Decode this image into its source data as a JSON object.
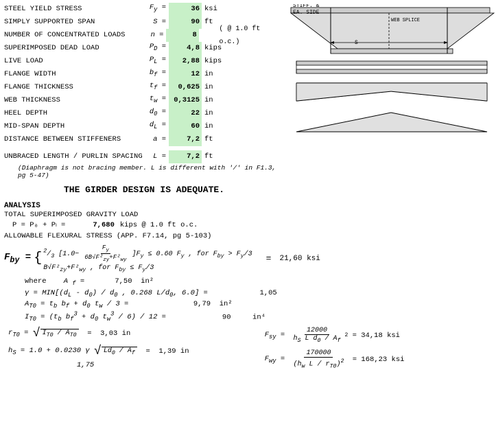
{
  "params": [
    {
      "label": "STEEL YIELD STRESS",
      "sym": "F y",
      "val": "36",
      "unit": "ksi",
      "note": ""
    },
    {
      "label": "SIMPLY SUPPORTED SPAN",
      "sym": "S",
      "val": "90",
      "unit": "ft",
      "note": ""
    },
    {
      "label": "NUMBER OF CONCENTRATED LOADS",
      "sym": "n",
      "val": "8",
      "unit": "",
      "note": "( @ 1.0 ft o.c.)"
    },
    {
      "label": "SUPERIMPOSED DEAD LOAD",
      "sym": "P D",
      "val": "4,8",
      "unit": "kips",
      "note": ""
    },
    {
      "label": "LIVE LOAD",
      "sym": "P L",
      "val": "2,88",
      "unit": "kips",
      "note": ""
    },
    {
      "label": "FLANGE WIDTH",
      "sym": "b f",
      "val": "12",
      "unit": "in",
      "note": ""
    },
    {
      "label": "FLANGE THICKNESS",
      "sym": "t f",
      "val": "0,625",
      "unit": "in",
      "note": ""
    },
    {
      "label": "WEB THICKNESS",
      "sym": "t w",
      "val": "0,3125",
      "unit": "in",
      "note": ""
    },
    {
      "label": "HEEL DEPTH",
      "sym": "d 0",
      "val": "22",
      "unit": "in",
      "note": ""
    },
    {
      "label": "MID-SPAN DEPTH",
      "sym": "d L",
      "val": "60",
      "unit": "in",
      "note": ""
    },
    {
      "label": "DISTANCE BETWEEN STIFFENERS",
      "sym": "a",
      "val": "7,2",
      "unit": "ft",
      "note": ""
    },
    {
      "label": "",
      "sym": "",
      "val": "",
      "unit": "",
      "note": ""
    },
    {
      "label": "UNBRACED LENGTH / PURLIN SPACING",
      "sym": "L",
      "val": "7,2",
      "unit": "ft",
      "note": ""
    }
  ],
  "diaphragm_note": "(Diaphragm is not bracing member. L is different with '/' in F1.3, pg 5-47)",
  "adequate_text": "THE GIRDER DESIGN IS ADEQUATE.",
  "analysis": {
    "title": "ANALYSIS",
    "gravity_label": "TOTAL SUPERIMPOSED GRAVITY LOAD",
    "gravity_eq": "P = P₀ + Pₗ =",
    "gravity_val": "7,680",
    "gravity_unit": "kips @ 1.0 ft o.c.",
    "flex_label": "ALLOWABLE FLEXURAL STRESS (APP. F7.14, pg 5-103)",
    "where_label": "where",
    "Af_label": "A f =",
    "Af_val": "7,50",
    "Af_unit": "in²",
    "gamma_label": "γ = MIN[(dₙ - d₀) / d₀ , 0.268 L/d₀, 6.0] =",
    "gamma_val": "1,05",
    "ATo_label": "A T₀ = tₙ bₙ + d₀ tₘ / 3 =",
    "ATo_val": "9,79",
    "ATo_unit": "in²",
    "ITo_label": "I T₀ = (tₙ bₙ³ + d₀ tₘ³ / 6) / 12 =",
    "ITo_val": "90",
    "ITo_unit": "in⁴",
    "r_label": "r T₀ =",
    "r_inner": "I T₀ / A T₀",
    "r_eq": "=",
    "r_val": "3,03",
    "r_unit": "in",
    "Fsy_label": "F sy =",
    "Fsy_num": "12000",
    "Fsy_den": "h S L d₀ / A f",
    "Fsy_eq": "=",
    "Fsy_val": "34,18",
    "Fsy_unit": "ksi",
    "hs_label": "h S = 1.0 + 0.0230 γ",
    "hs_inner": "Ld₀ / A f",
    "hs_eq": "=",
    "hs_val": "1,39",
    "hs_unit": "in",
    "Fwy_label": "F wy =",
    "Fwy_num": "170000",
    "Fwy_den": "(h w L / r T₀)²",
    "Fwy_eq": "=",
    "Fwy_val": "168,23",
    "Fwy_unit": "ksi",
    "last_val": "1,75"
  },
  "diagram": {
    "top_label": "STIFF. &",
    "ea_side": "EA. SIDE",
    "S_label": "S",
    "web_splice": "WEB SPLICE"
  }
}
